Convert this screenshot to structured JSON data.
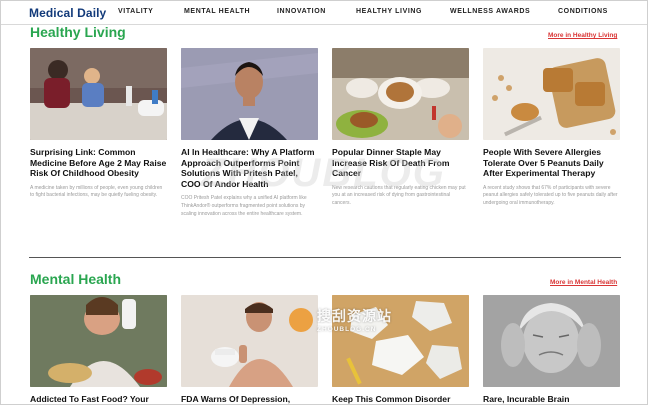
{
  "brand": {
    "logo_text": "Medical Daily"
  },
  "nav": {
    "items": [
      {
        "label": "VITALITY"
      },
      {
        "label": "MENTAL HEALTH"
      },
      {
        "label": "INNOVATION"
      },
      {
        "label": "HEALTHY LIVING"
      },
      {
        "label": "WELLNESS AWARDS"
      },
      {
        "label": "CONDITIONS"
      }
    ]
  },
  "healthy_living": {
    "title": "Healthy Living",
    "more_link": "More in Healthy Living",
    "cards": [
      {
        "headline": "Surprising Link: Common Medicine Before Age 2 May Raise Risk Of Childhood Obesity",
        "summary": "A medicine taken by millions of people, even young children to fight bacterial infections, may be quietly fueling obesity."
      },
      {
        "headline": "AI In Healthcare: Why A Platform Approach Outperforms Point Solutions With Pritesh Patel, COO Of Andor Health",
        "summary": "COO Pritesh Patel explains why a unified AI platform like ThinkAndor® outperforms fragmented point solutions by scaling innovation across the entire healthcare system."
      },
      {
        "headline": "Popular Dinner Staple May Increase Risk Of Death From Cancer",
        "summary": "New research cautions that regularly eating chicken may put you at an increased risk of dying from gastrointestinal cancers."
      },
      {
        "headline": "People With Severe Allergies Tolerate Over 5 Peanuts Daily After Experimental Therapy",
        "summary": "A recent study shows that 67% of participants with severe peanut allergies safely tolerated up to five peanuts daily after undergoing oral immunotherapy."
      }
    ]
  },
  "mental_health": {
    "title": "Mental Health",
    "more_link": "More in Mental Health",
    "cards": [
      {
        "headline": "Addicted To Fast Food? Your"
      },
      {
        "headline": "FDA Warns Of Depression,"
      },
      {
        "headline": "Keep This Common Disorder"
      },
      {
        "headline": "Rare, Incurable Brain"
      }
    ]
  },
  "watermarks": {
    "big": "ZHOUBLOG",
    "cn": "搜刮资源站",
    "en": "ZHOUBLOG.CN"
  }
}
